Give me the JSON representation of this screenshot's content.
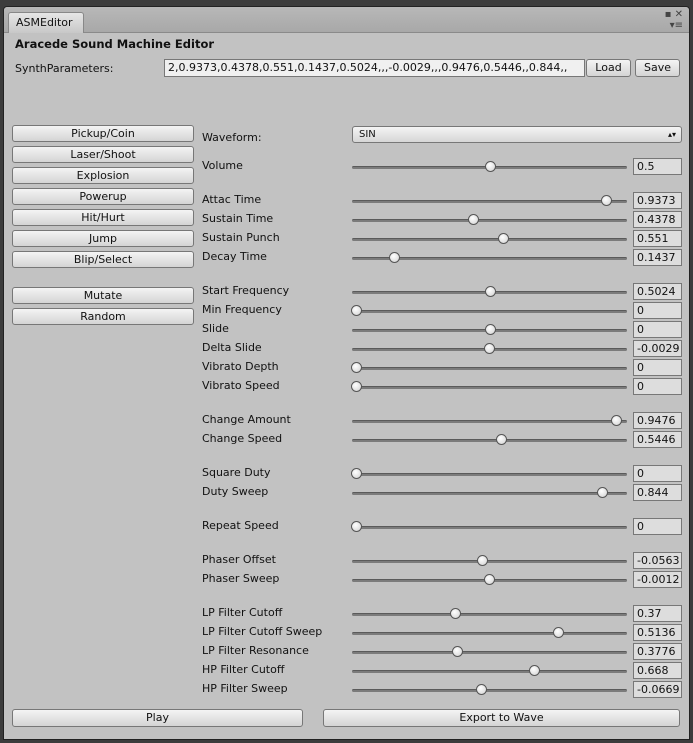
{
  "window": {
    "tab": "ASMEditor",
    "title": "Aracede Sound Machine Editor"
  },
  "synth": {
    "label": "SynthParameters:",
    "value": "2,0.9373,0.4378,0.551,0.1437,0.5024,,,-0.0029,,,0.9476,0.5446,,0.844,,",
    "load": "Load",
    "save": "Save"
  },
  "presets": [
    "Pickup/Coin",
    "Laser/Shoot",
    "Explosion",
    "Powerup",
    "Hit/Hurt",
    "Jump",
    "Blip/Select"
  ],
  "actions": [
    "Mutate",
    "Random"
  ],
  "waveform": {
    "label": "Waveform:",
    "value": "SIN"
  },
  "groups": [
    [
      {
        "label": "Volume",
        "value": "0.5",
        "v": 0.5,
        "min": 0,
        "max": 1
      }
    ],
    [
      {
        "label": "Attac Time",
        "value": "0.9373",
        "v": 0.9373,
        "min": 0,
        "max": 1
      },
      {
        "label": "Sustain Time",
        "value": "0.4378",
        "v": 0.4378,
        "min": 0,
        "max": 1
      },
      {
        "label": "Sustain Punch",
        "value": "0.551",
        "v": 0.551,
        "min": 0,
        "max": 1
      },
      {
        "label": "Decay Time",
        "value": "0.1437",
        "v": 0.1437,
        "min": 0,
        "max": 1
      }
    ],
    [
      {
        "label": "Start Frequency",
        "value": "0.5024",
        "v": 0.5024,
        "min": 0,
        "max": 1
      },
      {
        "label": "Min Frequency",
        "value": "0",
        "v": 0,
        "min": 0,
        "max": 1
      },
      {
        "label": "Slide",
        "value": "0",
        "v": 0,
        "min": -1,
        "max": 1
      },
      {
        "label": "Delta Slide",
        "value": "-0.0029",
        "v": -0.0029,
        "min": -1,
        "max": 1
      },
      {
        "label": "Vibrato Depth",
        "value": "0",
        "v": 0,
        "min": 0,
        "max": 1
      },
      {
        "label": "Vibrato Speed",
        "value": "0",
        "v": 0,
        "min": 0,
        "max": 1
      }
    ],
    [
      {
        "label": "Change Amount",
        "value": "0.9476",
        "v": 0.9476,
        "min": -1,
        "max": 1
      },
      {
        "label": "Change Speed",
        "value": "0.5446",
        "v": 0.5446,
        "min": 0,
        "max": 1
      }
    ],
    [
      {
        "label": "Square Duty",
        "value": "0",
        "v": 0,
        "min": 0,
        "max": 1
      },
      {
        "label": "Duty Sweep",
        "value": "0.844",
        "v": 0.844,
        "min": -1,
        "max": 1
      }
    ],
    [
      {
        "label": "Repeat Speed",
        "value": "0",
        "v": 0,
        "min": 0,
        "max": 1
      }
    ],
    [
      {
        "label": "Phaser Offset",
        "value": "-0.0563",
        "v": -0.0563,
        "min": -1,
        "max": 1
      },
      {
        "label": "Phaser Sweep",
        "value": "-0.0012",
        "v": -0.0012,
        "min": -1,
        "max": 1
      }
    ],
    [
      {
        "label": "LP Filter Cutoff",
        "value": "0.37",
        "v": 0.37,
        "min": 0,
        "max": 1
      },
      {
        "label": "LP Filter Cutoff Sweep",
        "value": "0.5136",
        "v": 0.5136,
        "min": -1,
        "max": 1
      },
      {
        "label": "LP Filter Resonance",
        "value": "0.3776",
        "v": 0.3776,
        "min": 0,
        "max": 1
      },
      {
        "label": "HP Filter Cutoff",
        "value": "0.668",
        "v": 0.668,
        "min": 0,
        "max": 1
      },
      {
        "label": "HP Filter Sweep",
        "value": "-0.0669",
        "v": -0.0669,
        "min": -1,
        "max": 1
      }
    ]
  ],
  "footer": {
    "play": "Play",
    "export": "Export to Wave"
  }
}
